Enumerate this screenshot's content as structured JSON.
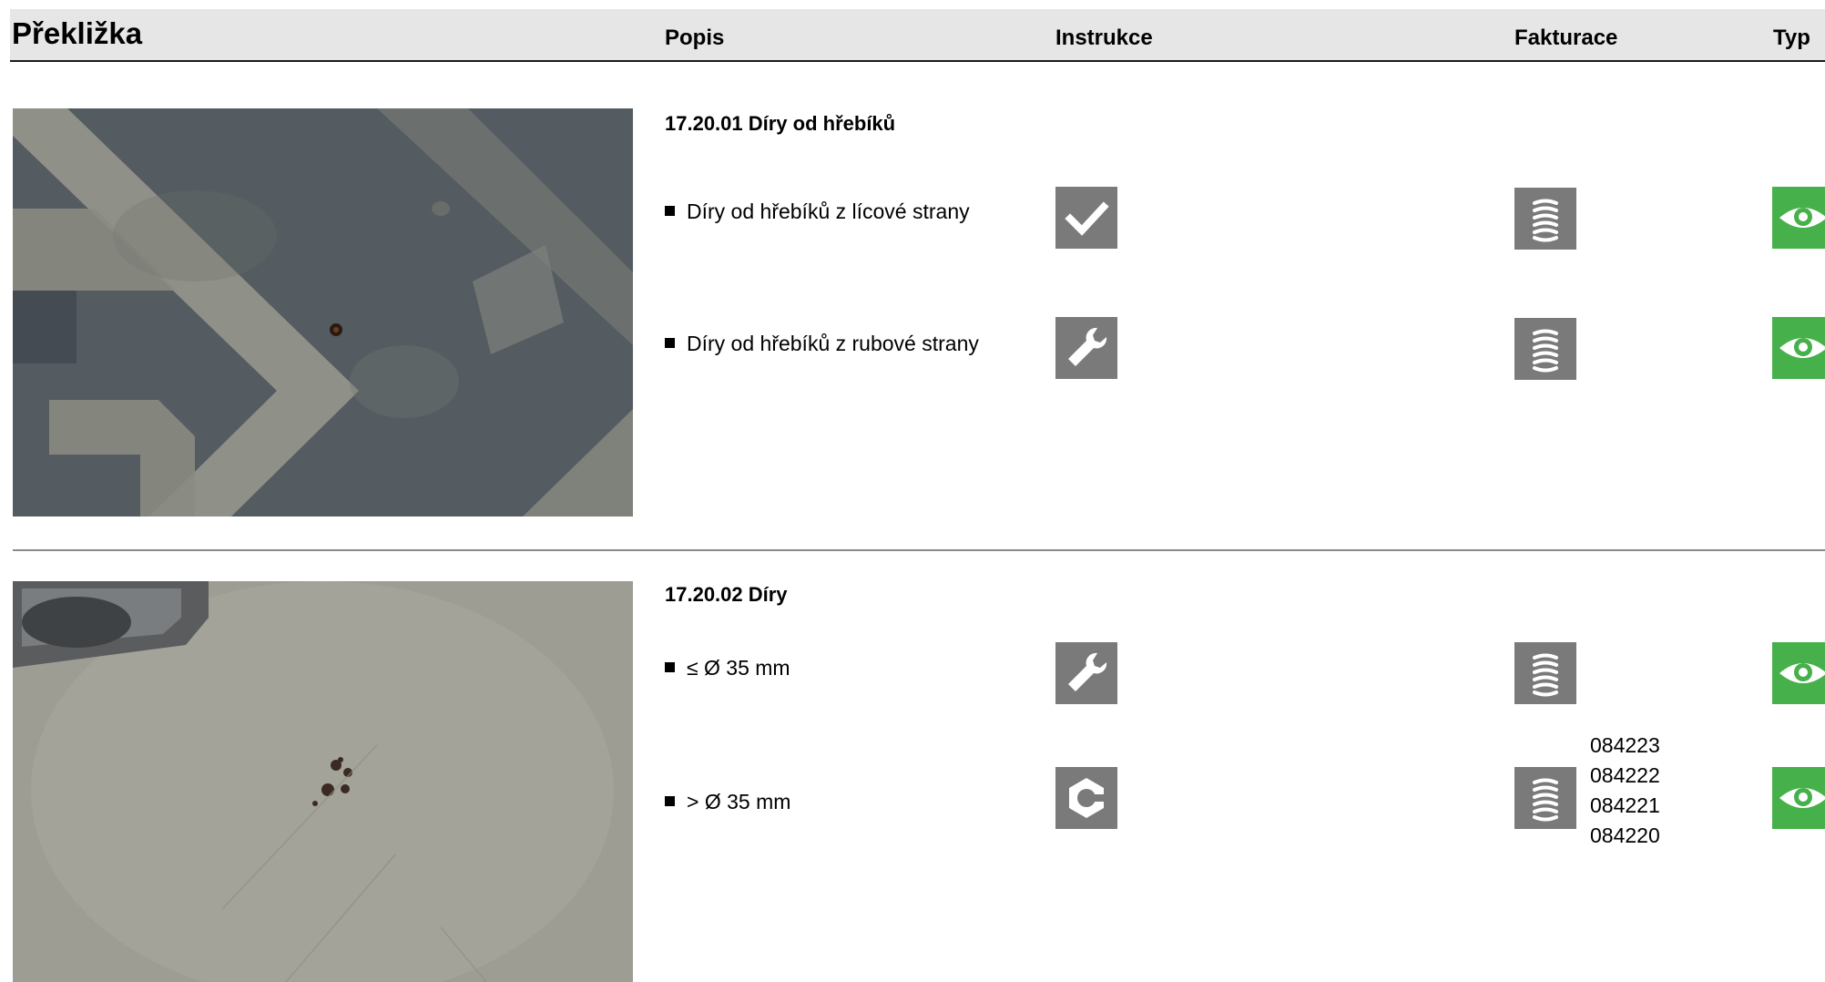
{
  "header": {
    "title": "Překližka",
    "columns": {
      "popis": "Popis",
      "instrukce": "Instrukce",
      "fakturace": "Fakturace",
      "typ": "Typ"
    }
  },
  "sections": [
    {
      "title": "17.20.01 Díry od hřebíků",
      "items": [
        {
          "label": "Díry od hřebíků z lícové strany",
          "instruction_icon": "checkmark-icon",
          "billing_icon": "stack-icon",
          "type_icon": "eye-icon"
        },
        {
          "label": "Díry od hřebíků z rubové strany",
          "instruction_icon": "wrench-icon",
          "billing_icon": "stack-icon",
          "type_icon": "eye-icon"
        }
      ]
    },
    {
      "title": "17.20.02 Díry",
      "items": [
        {
          "label": "≤ Ø 35 mm",
          "instruction_icon": "wrench-icon",
          "billing_icon": "stack-icon",
          "type_icon": "eye-icon"
        },
        {
          "label": "> Ø 35 mm",
          "instruction_icon": "hex-nut-icon",
          "billing_icon": "stack-icon",
          "type_icon": "eye-icon",
          "codes": [
            "084223",
            "084222",
            "084221",
            "084220"
          ]
        }
      ]
    }
  ],
  "colors": {
    "header_bg": "#e6e6e6",
    "icon_gray": "#7a7a7a",
    "icon_green": "#46b04a"
  }
}
